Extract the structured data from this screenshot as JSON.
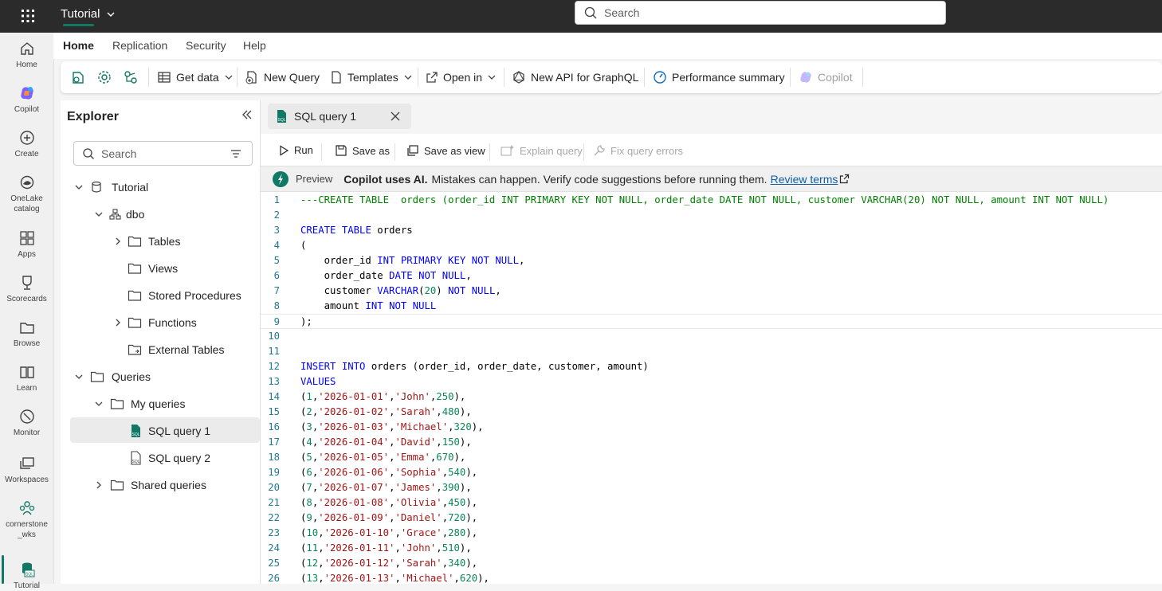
{
  "app": {
    "workspace_title": "Tutorial",
    "search_placeholder": "Search"
  },
  "left_nav": [
    {
      "label": "Home"
    },
    {
      "label": "Copilot"
    },
    {
      "label": "Create"
    },
    {
      "label": "OneLake catalog"
    },
    {
      "label": "Apps"
    },
    {
      "label": "Scorecards"
    },
    {
      "label": "Browse"
    },
    {
      "label": "Learn"
    },
    {
      "label": "Monitor"
    },
    {
      "label": "Workspaces"
    },
    {
      "label": "cornerstone _wks"
    },
    {
      "label": "Tutorial"
    }
  ],
  "menu_tabs": [
    "Home",
    "Replication",
    "Security",
    "Help"
  ],
  "ribbon": {
    "get_data": "Get data",
    "new_query": "New Query",
    "templates": "Templates",
    "open_in": "Open in",
    "new_api": "New API for GraphQL",
    "perf_summary": "Performance summary",
    "copilot": "Copilot"
  },
  "explorer": {
    "title": "Explorer",
    "search_placeholder": "Search",
    "tree": {
      "tutorial": "Tutorial",
      "dbo": "dbo",
      "tables": "Tables",
      "views": "Views",
      "stored_procedures": "Stored Procedures",
      "functions": "Functions",
      "external_tables": "External Tables",
      "queries": "Queries",
      "my_queries": "My queries",
      "sql_query_1": "SQL query 1",
      "sql_query_2": "SQL query 2",
      "shared_queries": "Shared queries"
    }
  },
  "editor": {
    "tab_label": "SQL query 1",
    "toolbar": {
      "run": "Run",
      "save_as": "Save as",
      "save_as_view": "Save as view",
      "explain_query": "Explain query",
      "fix_query_errors": "Fix query errors"
    },
    "copilot_bar": {
      "preview": "Preview",
      "bold_text": "Copilot uses AI.",
      "text": "Mistakes can happen. Verify code suggestions before running them.",
      "link": "Review terms"
    },
    "code_lines": [
      "---CREATE TABLE  orders (order_id INT PRIMARY KEY NOT NULL, order_date DATE NOT NULL, customer VARCHAR(20) NOT NULL, amount INT NOT NULL)",
      "",
      "CREATE TABLE orders",
      "(",
      "    order_id INT PRIMARY KEY NOT NULL,",
      "    order_date DATE NOT NULL,",
      "    customer VARCHAR(20) NOT NULL,",
      "    amount INT NOT NULL",
      ");",
      "",
      "",
      "INSERT INTO orders (order_id, order_date, customer, amount)",
      "VALUES",
      "(1,'2026-01-01','John',250),",
      "(2,'2026-01-02','Sarah',480),",
      "(3,'2026-01-03','Michael',320),",
      "(4,'2026-01-04','David',150),",
      "(5,'2026-01-05','Emma',670),",
      "(6,'2026-01-06','Sophia',540),",
      "(7,'2026-01-07','James',390),",
      "(8,'2026-01-08','Olivia',450),",
      "(9,'2026-01-09','Daniel',720),",
      "(10,'2026-01-10','Grace',280),",
      "(11,'2026-01-11','John',510),",
      "(12,'2026-01-12','Sarah',340),",
      "(13,'2026-01-13','Michael',620),"
    ],
    "current_line": 9
  },
  "colors": {
    "accent": "#117865",
    "keyword": "#0000ff",
    "string": "#a31515",
    "number": "#098658",
    "comment": "#008000",
    "line_number": "#237893"
  }
}
